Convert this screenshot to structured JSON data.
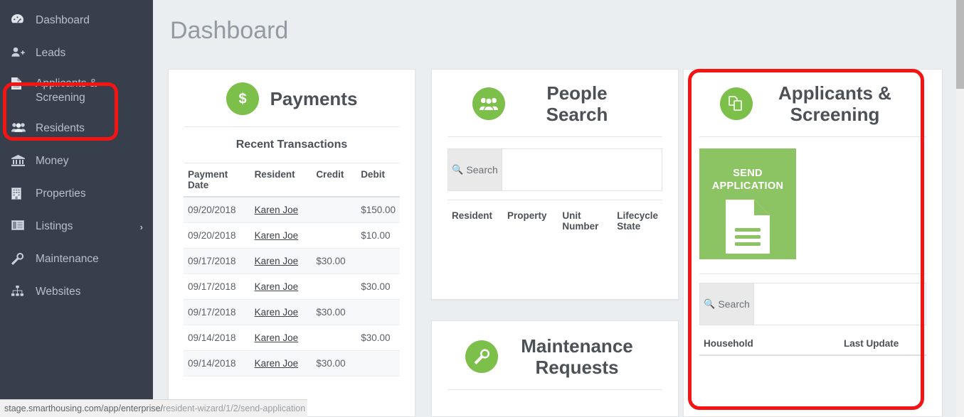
{
  "sidebar": {
    "items": [
      {
        "id": "dashboard",
        "label": "Dashboard",
        "icon": "tachometer-icon",
        "chevron": ""
      },
      {
        "id": "leads",
        "label": "Leads",
        "icon": "user-plus-icon",
        "chevron": ""
      },
      {
        "id": "applicants-screening",
        "label": "Applicants & Screening",
        "icon": "document-icon",
        "chevron": ""
      },
      {
        "id": "residents",
        "label": "Residents",
        "icon": "users-icon",
        "chevron": ""
      },
      {
        "id": "money",
        "label": "Money",
        "icon": "bank-icon",
        "chevron": ""
      },
      {
        "id": "properties",
        "label": "Properties",
        "icon": "building-icon",
        "chevron": ""
      },
      {
        "id": "listings",
        "label": "Listings",
        "icon": "list-window-icon",
        "chevron": "›"
      },
      {
        "id": "maintenance",
        "label": "Maintenance",
        "icon": "wrench-icon",
        "chevron": ""
      },
      {
        "id": "websites",
        "label": "Websites",
        "icon": "sitemap-icon",
        "chevron": ""
      }
    ]
  },
  "header": {
    "title": "Dashboard"
  },
  "payments_card": {
    "title": "Payments",
    "icon": "dollar-circle-icon",
    "subtitle": "Recent Transactions",
    "columns": [
      "Payment Date",
      "Resident",
      "Credit",
      "Debit"
    ],
    "rows": [
      {
        "date": "09/20/2018",
        "resident": "Karen Joe",
        "credit": "",
        "debit": "$150.00"
      },
      {
        "date": "09/20/2018",
        "resident": "Karen Joe",
        "credit": "",
        "debit": "$10.00"
      },
      {
        "date": "09/17/2018",
        "resident": "Karen Joe",
        "credit": "$30.00",
        "debit": ""
      },
      {
        "date": "09/17/2018",
        "resident": "Karen Joe",
        "credit": "",
        "debit": "$30.00"
      },
      {
        "date": "09/17/2018",
        "resident": "Karen Joe",
        "credit": "$30.00",
        "debit": ""
      },
      {
        "date": "09/14/2018",
        "resident": "Karen Joe",
        "credit": "",
        "debit": "$30.00"
      },
      {
        "date": "09/14/2018",
        "resident": "Karen Joe",
        "credit": "$30.00",
        "debit": ""
      }
    ]
  },
  "people_card": {
    "title": "People Search",
    "icon": "people-circle-icon",
    "search_label": "Search",
    "search_value": "",
    "search_placeholder": "",
    "columns": [
      "Resident",
      "Property",
      "Unit Number",
      "Lifecycle State"
    ]
  },
  "maintenance_card": {
    "title": "Maintenance Requests",
    "icon": "wrench-circle-icon"
  },
  "applicants_card": {
    "title": "Applicants & Screening",
    "icon": "copy-documents-circle-icon",
    "tile_label_line1": "SEND",
    "tile_label_line2": "APPLICATION",
    "tile_icon": "document-lines-icon",
    "search_label": "Search",
    "search_value": "",
    "search_placeholder": "",
    "columns": [
      "Household",
      "Last Update"
    ]
  },
  "status_bar": {
    "url_visible": "stage.smarthousing.com/app/enterprise/",
    "url_faded": "resident-wizard/1/2/send-application"
  },
  "colors": {
    "sidebar_bg": "#373f4c",
    "accent_green": "#7cbf4a",
    "tile_green": "#8dc463",
    "highlight_red": "#f51414",
    "page_bg": "#eaeef0",
    "title_gray": "#939aa1"
  }
}
